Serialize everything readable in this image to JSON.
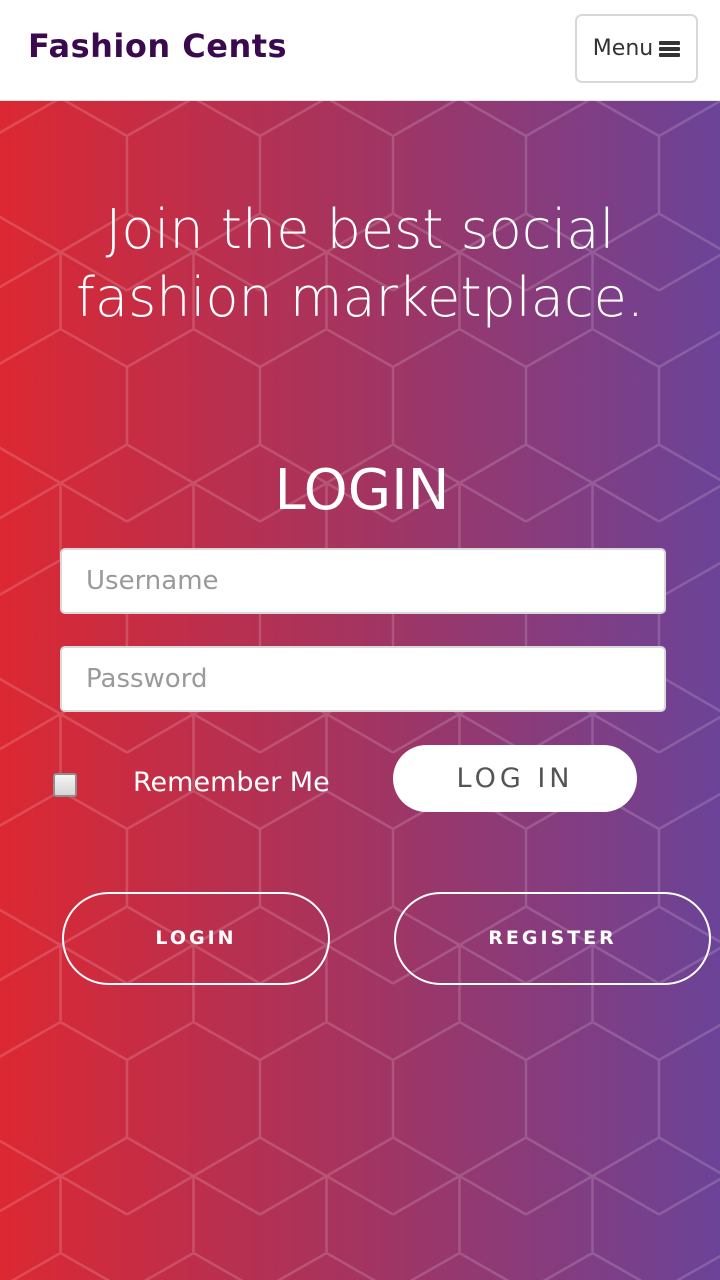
{
  "header": {
    "brand": "Fashion Cents",
    "menu_label": "Menu"
  },
  "hero": {
    "headline_line1": "Join the best social",
    "headline_line2": "fashion marketplace."
  },
  "login_form": {
    "title": "LOGIN",
    "username_placeholder": "Username",
    "password_placeholder": "Password",
    "remember_label": "Remember Me",
    "remember_checked": false,
    "submit_label": "LOG IN"
  },
  "tabs": {
    "login_label": "LOGIN",
    "register_label": "REGISTER"
  },
  "icons": {
    "menu": "bars-icon"
  },
  "colors": {
    "brand_text": "#3b0a4e",
    "gradient_start": "#dc2832",
    "gradient_mid": "#a43460",
    "gradient_end": "#6b4398",
    "pattern_line": "#ffffff"
  }
}
